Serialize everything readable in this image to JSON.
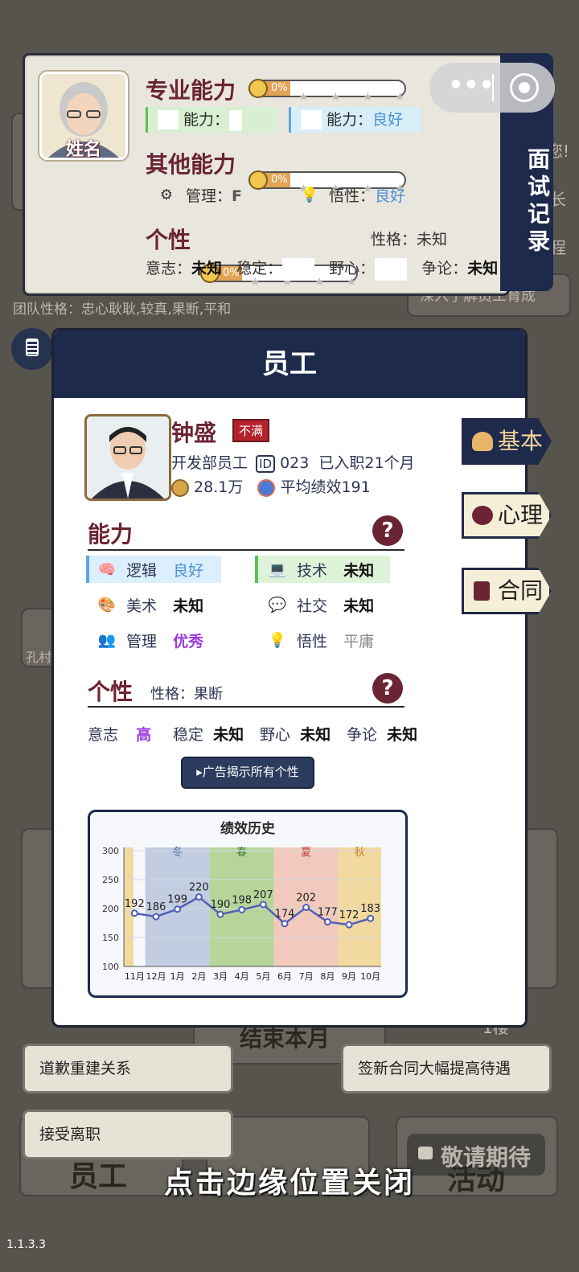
{
  "background": {
    "team_personality": "团队性格：忠心耿耿,较真,果断,平和",
    "finish_month": "结束本月",
    "floor": "1楼",
    "coming_soon": "敬请期待",
    "bottom_staff": "员工",
    "bottom_activity": "活动",
    "side_name": "孔村",
    "side_texts": [
      "您!",
      "长",
      "程"
    ],
    "deep_understand": "深入了解员工育成"
  },
  "interview_card": {
    "avatar_label": "姓名",
    "side_title": "面试记录",
    "professional": {
      "title": "专业能力",
      "percent": "0%",
      "chip1_label": "能力：",
      "chip2_label": "能力：",
      "chip2_value": "良好"
    },
    "other": {
      "title": "其他能力",
      "percent": "0%",
      "mgmt_label": "管理：",
      "mgmt_value": "F",
      "insight_label": "悟性：",
      "insight_value": "良好"
    },
    "personality": {
      "title": "个性",
      "percent": "0%",
      "char_label": "性格：",
      "char_value": "未知",
      "will_label": "意志：",
      "will_value": "未知",
      "stable_label": "稳定：",
      "ambition_label": "野心：",
      "debate_label": "争论：",
      "debate_value": "未知"
    }
  },
  "modal": {
    "title": "员工",
    "name": "钟盛",
    "status_badge": "不满",
    "department": "开发部员工",
    "id_tag": "ID",
    "id_value": "023",
    "tenure": "已入职21个月",
    "salary": "28.1万",
    "avg_perf": "平均绩效191",
    "ability_title": "能力",
    "help": "?",
    "abilities": [
      {
        "label": "逻辑",
        "value": "良好"
      },
      {
        "label": "技术",
        "value": "未知"
      },
      {
        "label": "美术",
        "value": "未知"
      },
      {
        "label": "社交",
        "value": "未知"
      },
      {
        "label": "管理",
        "value": "优秀"
      },
      {
        "label": "悟性",
        "value": "平庸"
      }
    ],
    "personality_title": "个性",
    "personality_char": "性格：果断",
    "traits": [
      {
        "label": "意志",
        "value": "高"
      },
      {
        "label": "稳定",
        "value": "未知"
      },
      {
        "label": "野心",
        "value": "未知"
      },
      {
        "label": "争论",
        "value": "未知"
      }
    ],
    "ad_button": "▸广告揭示所有个性"
  },
  "chart_data": {
    "type": "line",
    "title": "绩效历史",
    "categories": [
      "11月",
      "12月",
      "1月",
      "2月",
      "3月",
      "4月",
      "5月",
      "6月",
      "7月",
      "8月",
      "9月",
      "10月"
    ],
    "values": [
      192,
      186,
      199,
      220,
      190,
      198,
      207,
      174,
      202,
      177,
      172,
      183
    ],
    "seasons": [
      "冬",
      "春",
      "夏",
      "秋"
    ],
    "season_colors": [
      "#b8c6dc",
      "#a9cf8a",
      "#f0c2b2",
      "#f0d38e"
    ],
    "yticks": [
      300,
      250,
      200,
      150,
      100
    ],
    "ylim": [
      100,
      300
    ],
    "line_color": "#4f5fb8",
    "grid": true
  },
  "side_tabs": [
    "基本",
    "心理",
    "合同"
  ],
  "options": [
    "道歉重建关系",
    "签新合同大幅提高待遇",
    "接受离职"
  ],
  "close_hint": "点击边缘位置关闭",
  "version": "1.1.3.3"
}
